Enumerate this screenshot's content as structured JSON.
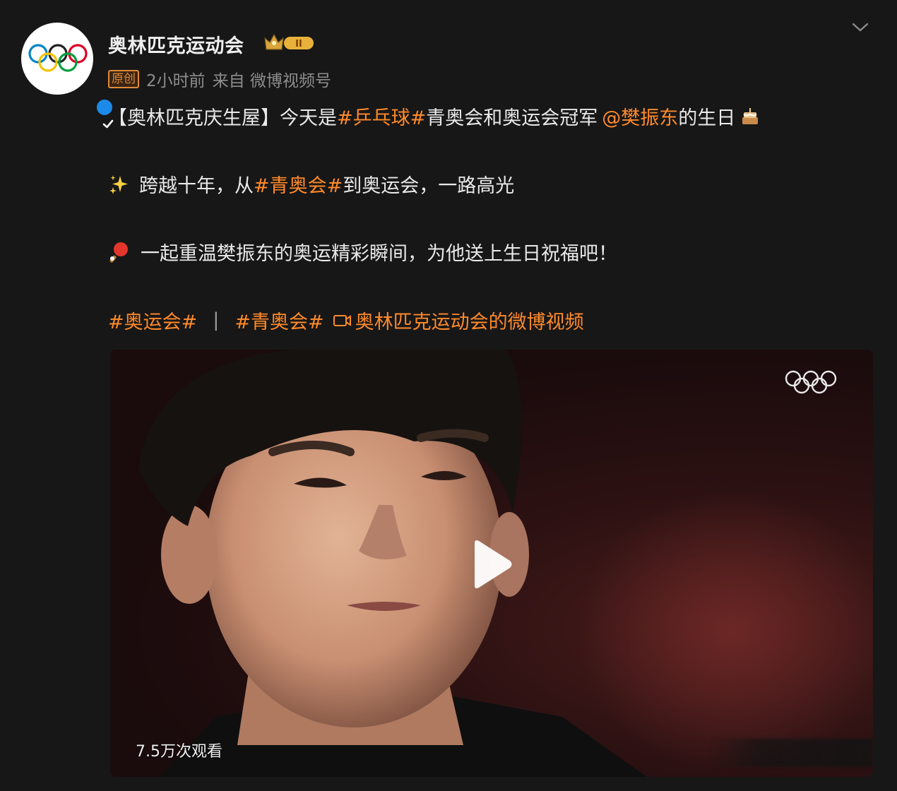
{
  "post": {
    "author": "奥林匹克运动会",
    "original_tag": "原创",
    "time": "2小时前",
    "source": "来自 微博视频号"
  },
  "content": {
    "p1_pre": "【奥林匹克庆生屋】今天是",
    "p1_topic": "#乒乓球#",
    "p1_mid": " 青奥会和奥运会冠军",
    "p1_mention": "@樊振东",
    "p1_post": " 的生日",
    "p2_pre": "跨越十年，从",
    "p2_topic": "#青奥会#",
    "p2_post": " 到奥运会，一路高光",
    "p3_text": "一起重温樊振东的奥运精彩瞬间，为他送上生日祝福吧！"
  },
  "links": {
    "topic1": "#奥运会#",
    "separator": "|",
    "topic2": "#青奥会#",
    "video_link": "奥林匹克运动会的微博视频"
  },
  "video": {
    "views": "7.5万次观看"
  },
  "icons": {
    "verified": "verified-badge-icon",
    "level": "crown-level-badge-icon",
    "collapse": "chevron-down-icon",
    "sparkle": "sparkles-icon",
    "pingpong": "ping-pong-icon",
    "cake": "birthday-cake-icon",
    "video": "video-camera-icon",
    "play": "play-icon"
  },
  "colors": {
    "background": "#171717",
    "link": "#ff8a2a",
    "verified": "#1b8ae8"
  }
}
